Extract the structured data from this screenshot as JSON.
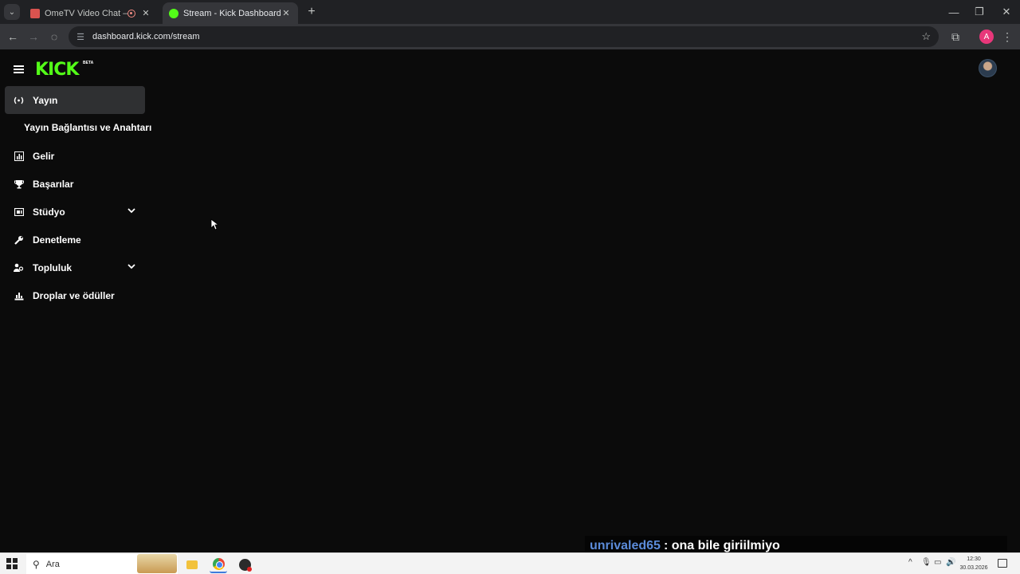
{
  "browser": {
    "tabs": [
      {
        "title": "OmeTV Video Chat — Ome",
        "active": false
      },
      {
        "title": "Stream - Kick Dashboard",
        "active": true
      }
    ],
    "url": "dashboard.kick.com/stream",
    "profile_initial": "A"
  },
  "app": {
    "logo": "KICK",
    "logo_badge": "BETA"
  },
  "sidebar": {
    "items": [
      {
        "label": "Yayın",
        "icon": "broadcast-icon",
        "active": true
      },
      {
        "label": "Gelir",
        "icon": "chart-icon"
      },
      {
        "label": "Başarılar",
        "icon": "trophy-icon"
      },
      {
        "label": "Stüdyo",
        "icon": "studio-icon",
        "expandable": true
      },
      {
        "label": "Denetleme",
        "icon": "wrench-icon"
      },
      {
        "label": "Topluluk",
        "icon": "community-icon",
        "expandable": true
      },
      {
        "label": "Droplar ve ödüller",
        "icon": "drops-icon"
      }
    ],
    "subitem": "Yayın Bağlantısı ve Anahtarı"
  },
  "chat_overlay": {
    "user": "unrivaled65",
    "message": ": ona bile giriilmiyo"
  },
  "taskbar": {
    "search_placeholder": "Ara",
    "time": "12:30",
    "date": "30.03.2026"
  },
  "colors": {
    "kick_green": "#53fc18",
    "chat_user": "#5b8bd9"
  }
}
